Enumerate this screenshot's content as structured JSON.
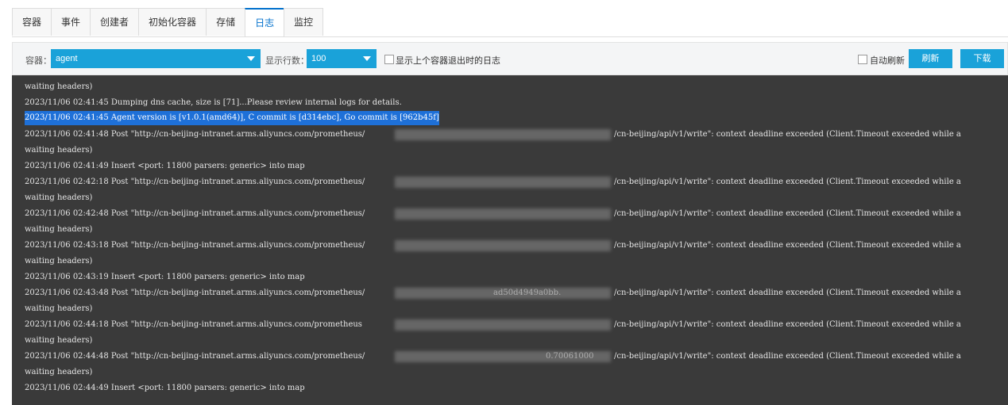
{
  "tabs": [
    {
      "label": "容器"
    },
    {
      "label": "事件"
    },
    {
      "label": "创建者"
    },
    {
      "label": "初始化容器"
    },
    {
      "label": "存储"
    },
    {
      "label": "日志",
      "active": true
    },
    {
      "label": "监控"
    }
  ],
  "toolbar": {
    "container_label": "容器：",
    "container_value": "agent",
    "rows_label": "显示行数：",
    "rows_value": "100",
    "prev_checkbox_label": "显示上个容器退出时的日志",
    "auto_refresh_label": "自动刷新",
    "refresh_button": "刷新",
    "download_button": "下载"
  },
  "colors": {
    "accent": "#1aa2d9",
    "tab_active": "#0070cc",
    "log_bg": "#3a3a3a",
    "selection": "#1e70d8"
  },
  "log_lines": [
    "waiting headers)",
    "2023/11/06 02:41:45 Dumping dns cache, size is [71]...Please review internal logs for details.",
    "2023/11/06 02:41:45 Agent version is [v1.0.1(amd64)], C commit is [d314ebc], Go commit is [962b45f]",
    "2023/11/06 02:41:48 Post \"http://cn-beijing-intranet.arms.aliyuncs.com/prometheus/",
    "waiting headers)",
    "2023/11/06 02:41:49 Insert <port: 11800 parsers: generic> into map",
    "2023/11/06 02:42:18 Post \"http://cn-beijing-intranet.arms.aliyuncs.com/prometheus/",
    "waiting headers)",
    "2023/11/06 02:42:48 Post \"http://cn-beijing-intranet.arms.aliyuncs.com/prometheus/",
    "waiting headers)",
    "2023/11/06 02:43:18 Post \"http://cn-beijing-intranet.arms.aliyuncs.com/prometheus/",
    "waiting headers)",
    "2023/11/06 02:43:19 Insert <port: 11800 parsers: generic> into map",
    "2023/11/06 02:43:48 Post \"http://cn-beijing-intranet.arms.aliyuncs.com/prometheus/",
    "waiting headers)",
    "2023/11/06 02:44:18 Post \"http://cn-beijing-intranet.arms.aliyuncs.com/prometheus",
    "waiting headers)",
    "2023/11/06 02:44:48 Post \"http://cn-beijing-intranet.arms.aliyuncs.com/prometheus/",
    "waiting headers)",
    "2023/11/06 02:44:49 Insert <port: 11800 parsers: generic> into map"
  ],
  "post_suffix": "/cn-beijing/api/v1/write\": context deadline exceeded (Client.Timeout exceeded while a",
  "partial_fragments": {
    "f13": "ad50d4949a0bb.",
    "f17": "0.70061000"
  }
}
